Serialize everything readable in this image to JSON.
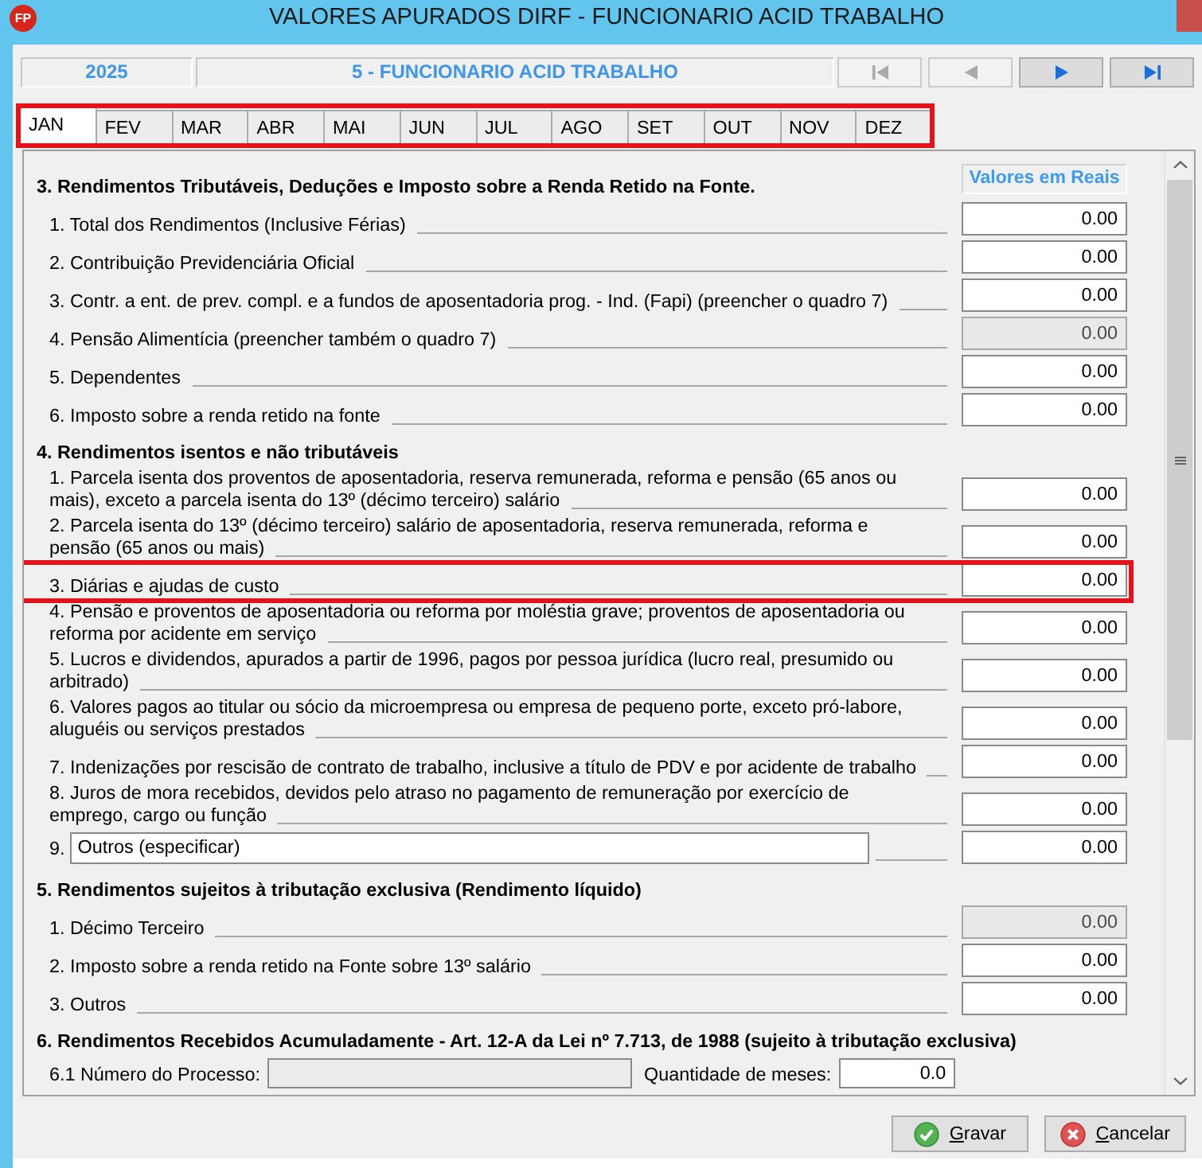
{
  "window": {
    "title": "VALORES APURADOS DIRF - FUNCIONARIO ACID TRABALHO",
    "app_logo": "FP"
  },
  "header": {
    "year": "2025",
    "employee": "5 - FUNCIONARIO ACID TRABALHO",
    "nav_buttons": [
      {
        "kind": "first",
        "disabled": true
      },
      {
        "kind": "previous",
        "disabled": true
      },
      {
        "kind": "next",
        "disabled": false
      },
      {
        "kind": "last",
        "disabled": false
      }
    ]
  },
  "month_tabs": {
    "highlighted": true,
    "tabs": [
      {
        "label": "JAN",
        "selected": true
      },
      {
        "label": "FEV",
        "selected": false
      },
      {
        "label": "MAR",
        "selected": false
      },
      {
        "label": "ABR",
        "selected": false
      },
      {
        "label": "MAI",
        "selected": false
      },
      {
        "label": "JUN",
        "selected": false
      },
      {
        "label": "JUL",
        "selected": false
      },
      {
        "label": "AGO",
        "selected": false
      },
      {
        "label": "SET",
        "selected": false
      },
      {
        "label": "OUT",
        "selected": false
      },
      {
        "label": "NOV",
        "selected": false
      },
      {
        "label": "DEZ",
        "selected": false
      }
    ]
  },
  "sections": [
    {
      "title": "3. Rendimentos Tributáveis, Deduções e Imposto sobre a Renda Retido na Fonte.",
      "column_header": "Valores em Reais",
      "rows": [
        {
          "kind": "amount",
          "label": "1. Total dos Rendimentos (Inclusive Férias)",
          "value": "0.00",
          "disabled": false,
          "highlighted": false
        },
        {
          "kind": "amount",
          "label": "2. Contribuição Previdenciária Oficial",
          "value": "0.00",
          "disabled": false,
          "highlighted": false
        },
        {
          "kind": "amount",
          "label": "3. Contr. a ent. de prev. compl. e a fundos de aposentadoria prog. - Ind. (Fapi) (preencher o quadro 7)",
          "value": "0.00",
          "disabled": false,
          "highlighted": false
        },
        {
          "kind": "amount",
          "label": "4. Pensão Alimentícia (preencher também o quadro 7)",
          "value": "0.00",
          "disabled": true,
          "highlighted": false
        },
        {
          "kind": "amount",
          "label": "5. Dependentes",
          "value": "0.00",
          "disabled": false,
          "highlighted": false
        },
        {
          "kind": "amount",
          "label": "6. Imposto sobre a renda retido na fonte",
          "value": "0.00",
          "disabled": false,
          "highlighted": false
        }
      ]
    },
    {
      "title": "4. Rendimentos isentos e não tributáveis",
      "rows": [
        {
          "kind": "amount",
          "label": "1. Parcela isenta dos proventos de aposentadoria, reserva remunerada, reforma e pensão (65 anos ou mais), exceto a parcela isenta do 13º (décimo terceiro) salário",
          "value": "0.00",
          "disabled": false,
          "highlighted": false
        },
        {
          "kind": "amount",
          "label": "2. Parcela isenta do 13º (décimo terceiro) salário de aposentadoria, reserva remunerada, reforma e pensão (65 anos ou mais)",
          "value": "0.00",
          "disabled": false,
          "highlighted": false
        },
        {
          "kind": "amount",
          "label": "3. Diárias e ajudas de custo",
          "value": "0.00",
          "disabled": false,
          "highlighted": true
        },
        {
          "kind": "amount",
          "label": "4. Pensão e proventos de aposentadoria ou reforma por moléstia grave; proventos de aposentadoria ou reforma por acidente em serviço",
          "value": "0.00",
          "disabled": false,
          "highlighted": false
        },
        {
          "kind": "amount",
          "label": "5. Lucros e dividendos, apurados a partir de 1996, pagos por pessoa jurídica (lucro real, presumido ou arbitrado)",
          "value": "0.00",
          "disabled": false,
          "highlighted": false
        },
        {
          "kind": "amount",
          "label": "6. Valores pagos ao titular ou sócio da microempresa ou empresa de pequeno porte, exceto pró-labore, aluguéis ou serviços prestados",
          "value": "0.00",
          "disabled": false,
          "highlighted": false
        },
        {
          "kind": "amount",
          "label": "7. Indenizações por rescisão de contrato de trabalho, inclusive a título de PDV e por acidente de trabalho",
          "value": "0.00",
          "disabled": false,
          "highlighted": false
        },
        {
          "kind": "amount",
          "label": "8. Juros de mora recebidos, devidos pelo atraso no pagamento de remuneração por exercício de emprego, cargo ou função",
          "value": "0.00",
          "disabled": false,
          "highlighted": false
        },
        {
          "kind": "specify",
          "number": "9.",
          "description": "Outros (especificar)",
          "value": "0.00",
          "disabled": false,
          "highlighted": false
        }
      ]
    },
    {
      "title": "5. Rendimentos sujeitos à tributação exclusiva (Rendimento líquido)",
      "rows": [
        {
          "kind": "amount",
          "label": "1. Décimo Terceiro",
          "value": "0.00",
          "disabled": true,
          "highlighted": false
        },
        {
          "kind": "amount",
          "label": "2. Imposto sobre a renda retido na Fonte sobre 13º salário",
          "value": "0.00",
          "disabled": false,
          "highlighted": false
        },
        {
          "kind": "amount",
          "label": "3. Outros",
          "value": "0.00",
          "disabled": false,
          "highlighted": false
        }
      ]
    },
    {
      "title": "6. Rendimentos Recebidos Acumuladamente - Art. 12-A da Lei nº 7.713, de 1988 (sujeito à tributação exclusiva)",
      "rows": [
        {
          "kind": "process",
          "label": "6.1 Número do Processo:",
          "process_disabled": true,
          "months_label": "Quantidade de meses:",
          "months_value": "0.0",
          "highlighted": false
        }
      ]
    }
  ],
  "buttons": [
    {
      "kind": "save",
      "label": "Gravar"
    },
    {
      "kind": "cancel",
      "label": "Cancelar"
    }
  ]
}
